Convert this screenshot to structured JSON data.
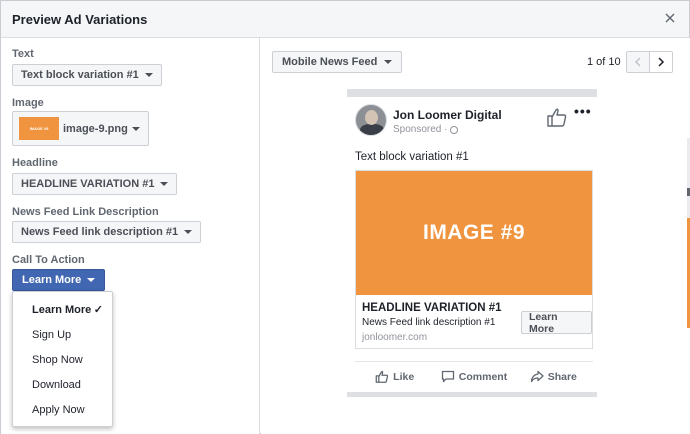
{
  "modal": {
    "title": "Preview Ad Variations"
  },
  "form": {
    "text_label": "Text",
    "text_value": "Text block variation #1",
    "image_label": "Image",
    "image_thumb_text": "IMAGE #9",
    "image_value": "image-9.png",
    "headline_label": "Headline",
    "headline_value": "HEADLINE VARIATION #1",
    "description_label": "News Feed Link Description",
    "description_value": "News Feed link description #1",
    "cta_label": "Call To Action",
    "cta_value": "Learn More",
    "cta_options": [
      "Learn More",
      "Sign Up",
      "Shop Now",
      "Download",
      "Apply Now"
    ],
    "cta_selected_check": "✓"
  },
  "preview": {
    "placement": "Mobile News Feed",
    "page_count": "1 of 10",
    "post": {
      "page_name": "Jon Loomer Digital",
      "sponsored": "Sponsored ·",
      "more": "•••",
      "text": "Text block variation #1",
      "image_text": "IMAGE #9",
      "headline": "HEADLINE VARIATION #1",
      "description": "News Feed link description #1",
      "domain": "jonloomer.com",
      "cta": "Learn More"
    },
    "actions": {
      "like": "Like",
      "comment": "Comment",
      "share": "Share"
    }
  },
  "colors": {
    "accent": "#4267b2",
    "image_bg": "#f0943f",
    "header_bg": "#f5f6f7"
  }
}
